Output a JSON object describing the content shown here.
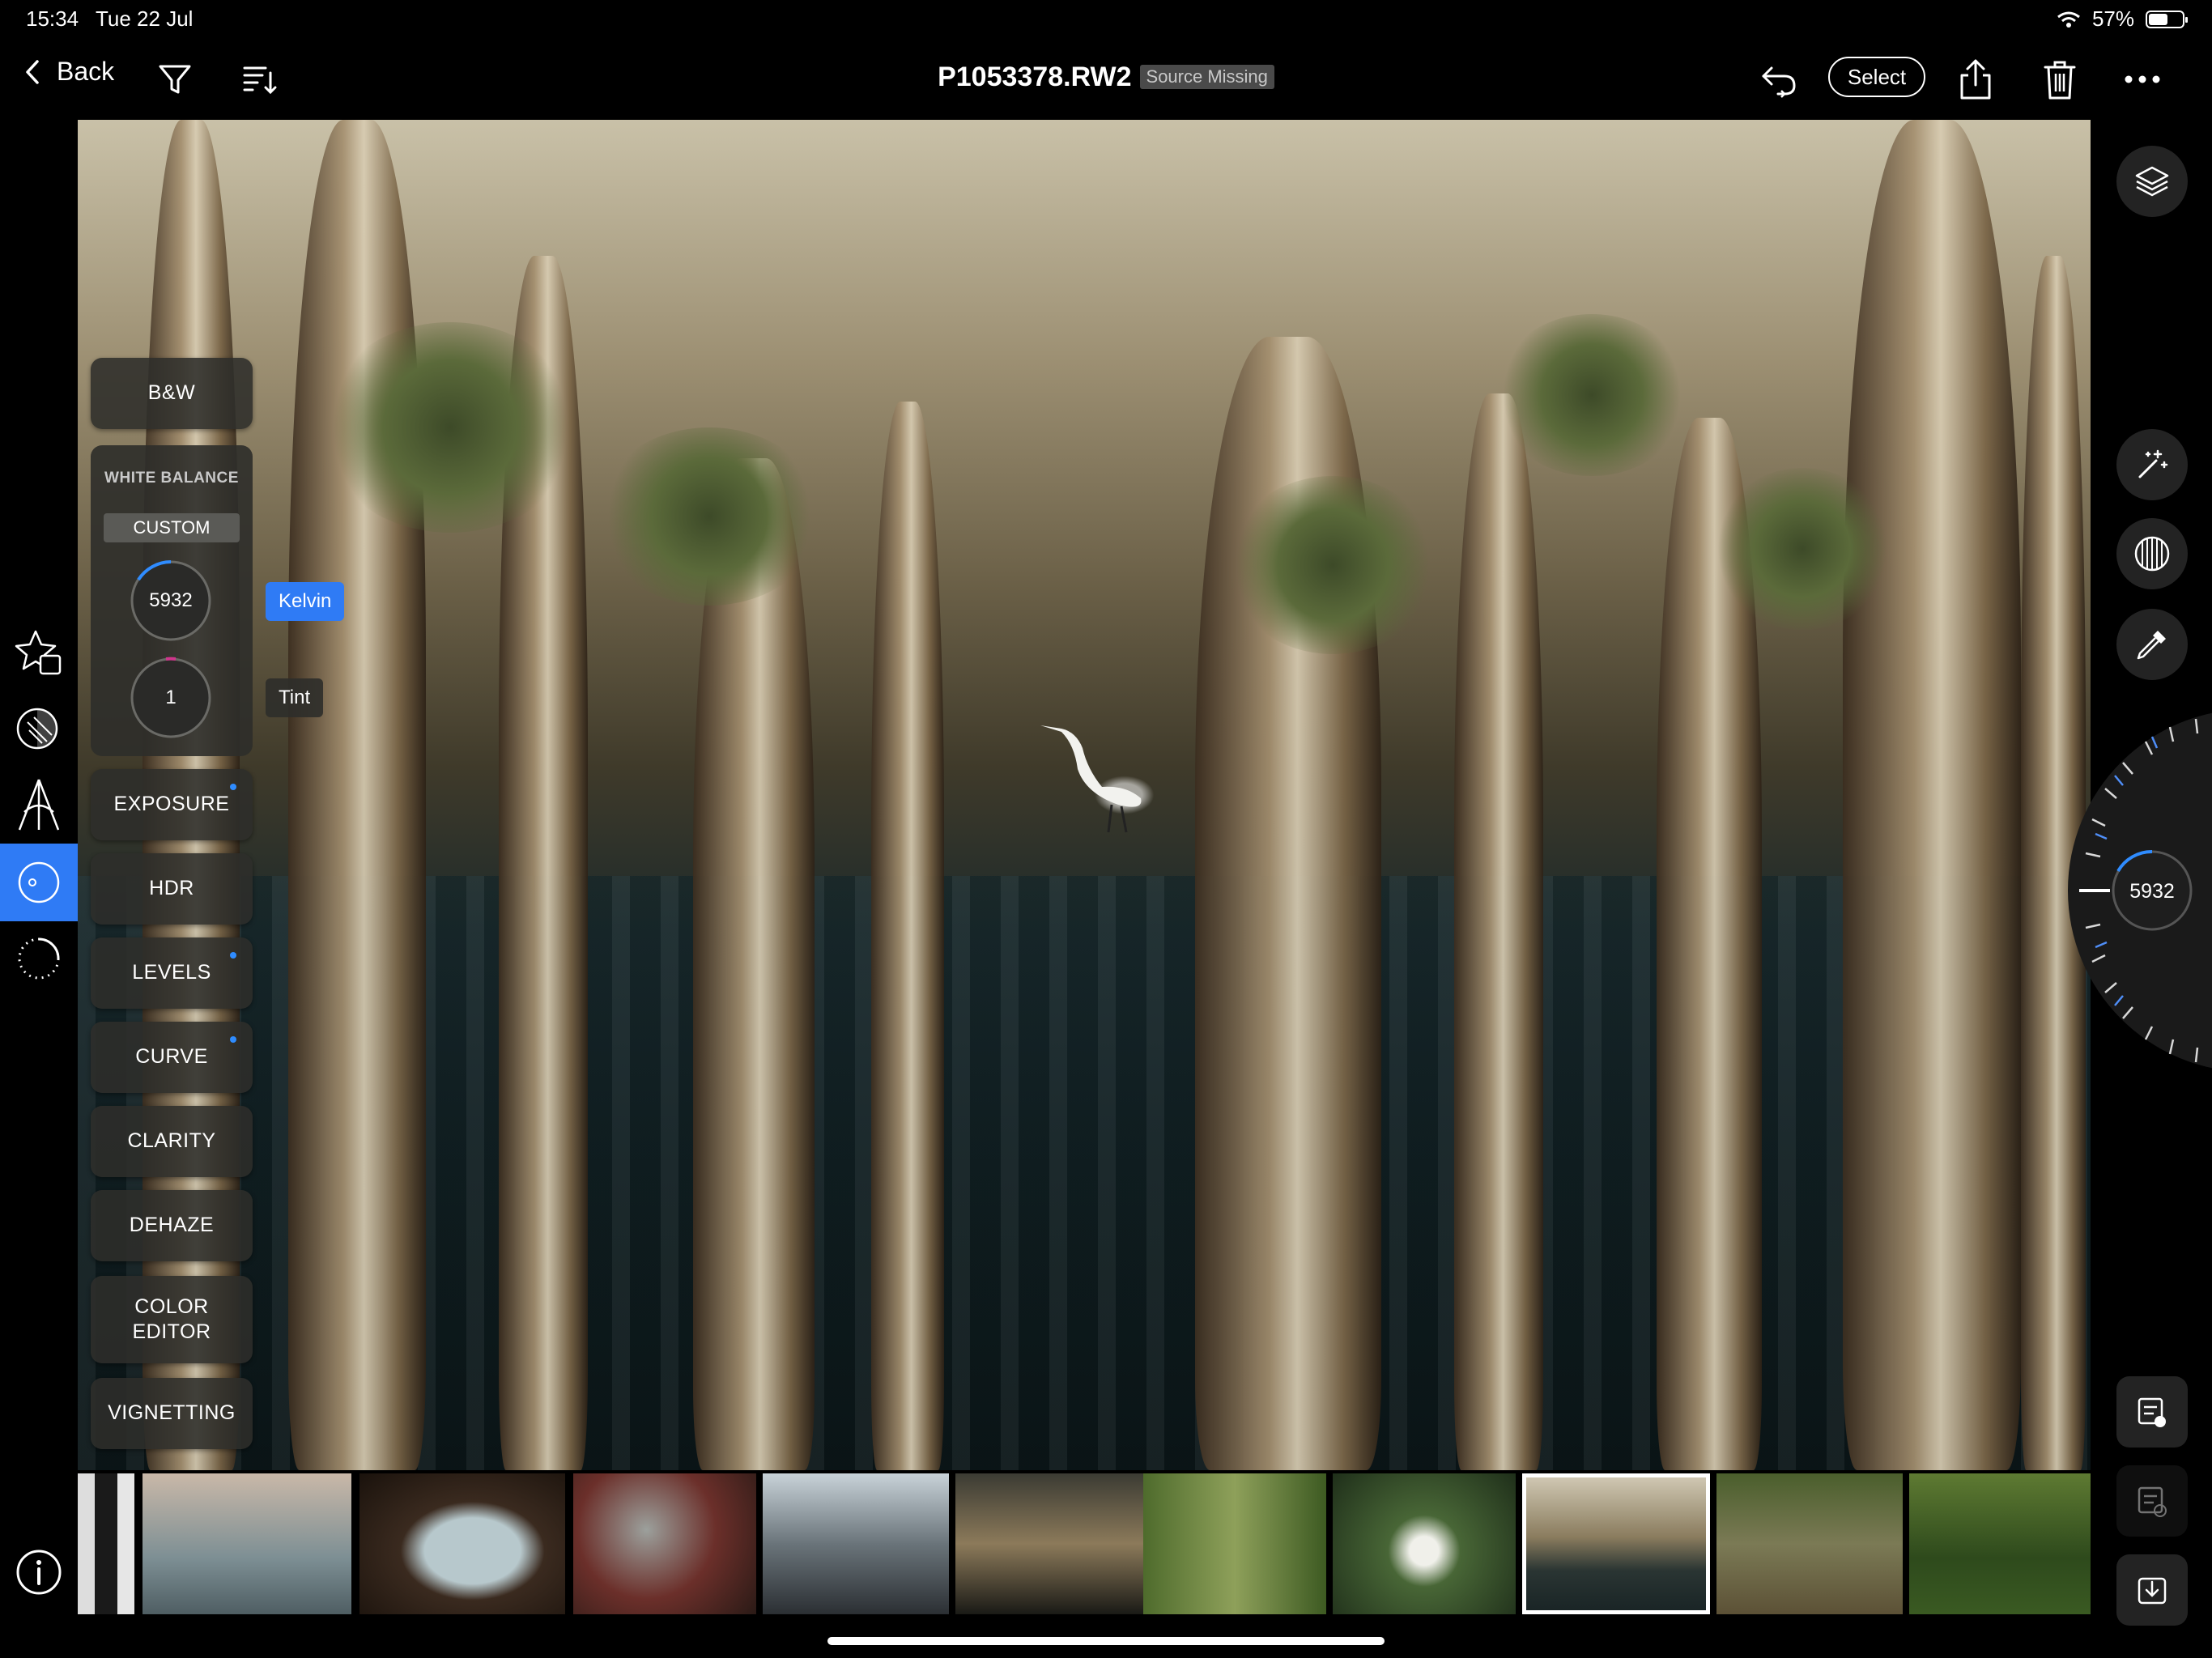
{
  "status_bar": {
    "time": "15:34",
    "date": "Tue 22 Jul",
    "battery": "57%",
    "battery_level": 0.57
  },
  "toolbar": {
    "back_label": "Back",
    "file_name": "P1053378.RW2",
    "badge": "Source Missing",
    "select_label": "Select"
  },
  "adjustments": {
    "bw": "B&W",
    "white_balance": {
      "header": "WHITE BALANCE",
      "mode": "CUSTOM",
      "kelvin_value": "5932",
      "tint_value": "1"
    },
    "kelvin_label": "Kelvin",
    "tint_label": "Tint",
    "exposure": "EXPOSURE",
    "hdr": "HDR",
    "levels": "LEVELS",
    "curve": "CURVE",
    "clarity": "CLARITY",
    "dehaze": "DEHAZE",
    "color_editor": "COLOR\nEDITOR",
    "vignetting": "VIGNETTING"
  },
  "dial": {
    "value": "5932"
  },
  "filmstrip": {
    "count": 11,
    "selected_index": 8
  },
  "colors": {
    "accent": "#2f7bf5",
    "panel": "#2d2d2a",
    "background": "#000000"
  },
  "icons": {
    "back": "chevron-left-icon",
    "filter": "filter-icon",
    "sort": "sort-icon",
    "undo": "undo-icon",
    "share": "share-icon",
    "trash": "trash-icon",
    "more": "more-icon",
    "layers": "layers-icon",
    "auto": "magic-wand-icon",
    "mask": "mask-icon",
    "picker": "eyedropper-icon",
    "info": "info-icon"
  }
}
